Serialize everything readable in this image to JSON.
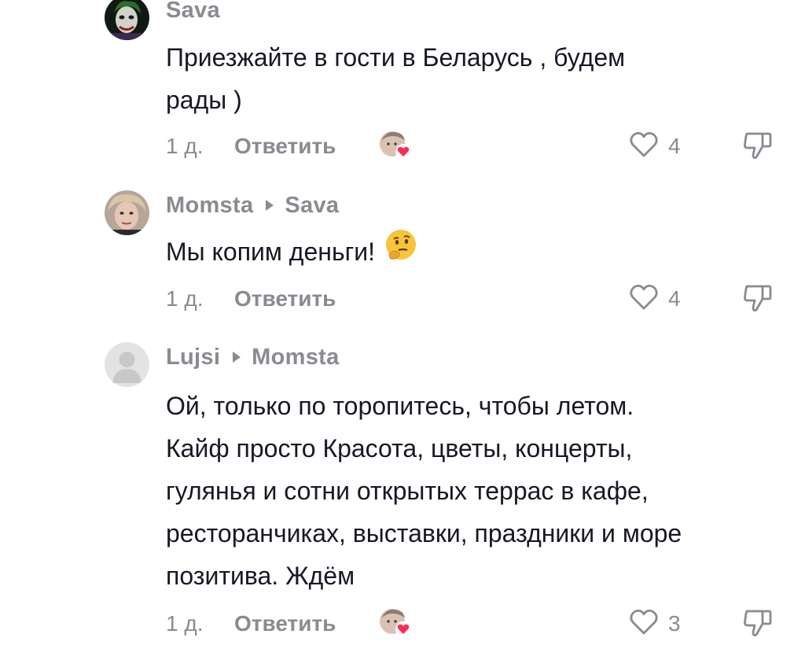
{
  "comments": [
    {
      "author": "Sava",
      "reply_to": "",
      "lines": [
        "Приезжайте в гости в Беларусь , будем",
        "рады )"
      ],
      "time": "1 д.",
      "reply_label": "Ответить",
      "likes": "4"
    },
    {
      "author": "Momsta",
      "reply_to": "Sava",
      "lines": [
        "Мы копим деньги!"
      ],
      "time": "1 д.",
      "reply_label": "Ответить",
      "likes": "4"
    },
    {
      "author": "Lujsi",
      "reply_to": "Momsta",
      "lines": [
        "Ой, только по торопитесь, чтобы летом.",
        "Кайф просто Красота, цветы, концерты,",
        "гулянья и сотни открытых террас в кафе,",
        "ресторанчиках, выставки, праздники и море",
        "позитива. Ждём"
      ],
      "time": "1 д.",
      "reply_label": "Ответить",
      "likes": "3"
    }
  ],
  "icons": {
    "like": "heart-outline-icon",
    "dislike": "thumbs-down-outline-icon",
    "creator_liked": "creator-liked-avatar-icon",
    "emoji": "thinking-face-emoji"
  },
  "colors": {
    "text": "#161823",
    "secondary": "#8a8b91",
    "heart_badge": "#fe2c55"
  }
}
